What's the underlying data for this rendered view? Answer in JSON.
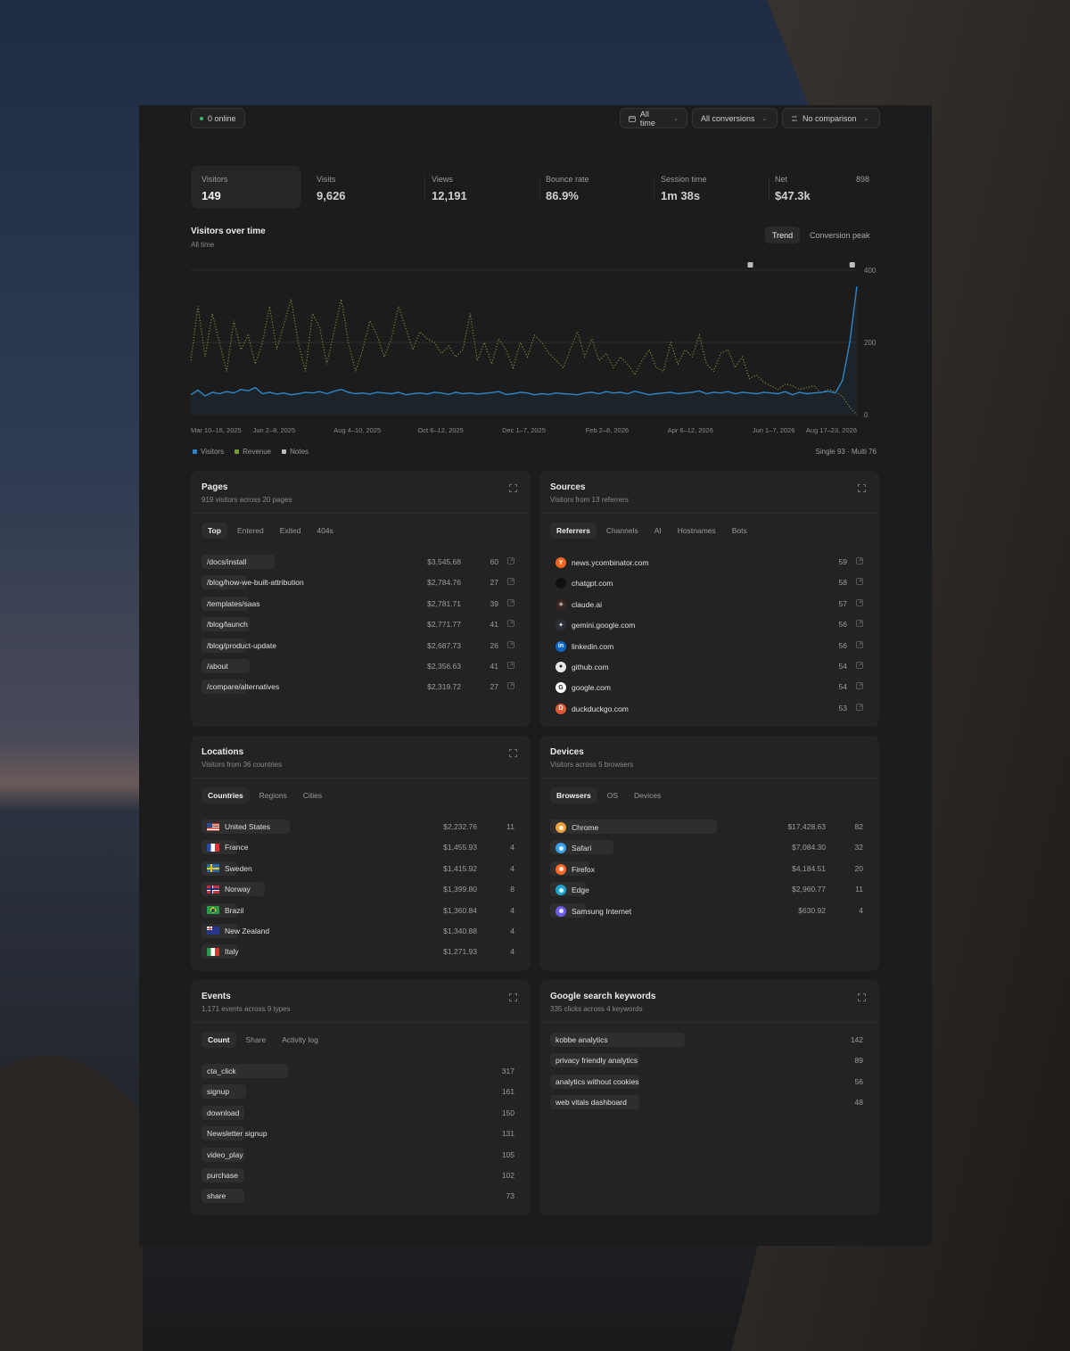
{
  "topbar": {
    "online": "0 online",
    "range": "All time",
    "conversions": "All conversions",
    "comparison": "No comparison"
  },
  "stats": [
    {
      "label": "Visitors",
      "value": "149"
    },
    {
      "label": "Visits",
      "value": "9,626"
    },
    {
      "label": "Views",
      "value": "12,191"
    },
    {
      "label": "Bounce rate",
      "value": "86.9%"
    },
    {
      "label": "Session time",
      "value": "1m 38s"
    },
    {
      "label": "Net",
      "value": "$47.3k",
      "extra": "898"
    }
  ],
  "chart": {
    "title": "Visitors over time",
    "subtitle": "All time",
    "toggle_trend": "Trend",
    "toggle_peak": "Conversion peak",
    "legend_right": "Single 93 · Multi 76",
    "colors": {
      "visitors": "#2e86c8",
      "revenue": "#8a8a3a",
      "notes": "#bdbdbd"
    }
  },
  "chart_data": {
    "type": "line",
    "x": [
      "Mar 10–16, 2025",
      "Jun 2–8, 2025",
      "Aug 4–10, 2025",
      "Oct 6–12, 2025",
      "Dec 1–7, 2025",
      "Feb 2–8, 2026",
      "Apr 6–12, 2026",
      "Jun 1–7, 2026",
      "Aug 17–23, 2026"
    ],
    "ylim": [
      0,
      400
    ],
    "yticks": [
      "0",
      "200",
      "400"
    ],
    "legend": [
      "Visitors",
      "Revenue",
      "Notes"
    ],
    "series": [
      {
        "name": "Visitors",
        "style": "solid",
        "color": "#2e86c8",
        "values": [
          55,
          68,
          52,
          62,
          58,
          64,
          60,
          70,
          66,
          75,
          58,
          62,
          57,
          60,
          55,
          58,
          62,
          60,
          64,
          58,
          65,
          70,
          62,
          58,
          60,
          57,
          62,
          60,
          58,
          62,
          55,
          58,
          60,
          57,
          62,
          60,
          56,
          62,
          58,
          60,
          57,
          59,
          61,
          64,
          56,
          58,
          62,
          60,
          55,
          58,
          56,
          60,
          58,
          57,
          55,
          60,
          62,
          58,
          64,
          60,
          62,
          58,
          65,
          60,
          55,
          58,
          60,
          62,
          58,
          60,
          62,
          66,
          58,
          62,
          60,
          64,
          58,
          62,
          60,
          58,
          62,
          60,
          58,
          64,
          55,
          62,
          58,
          60,
          62,
          65,
          60,
          95,
          200,
          355
        ]
      },
      {
        "name": "Revenue",
        "style": "dotted",
        "color": "#8a8a3a",
        "values": [
          150,
          300,
          160,
          280,
          200,
          120,
          260,
          180,
          220,
          140,
          200,
          300,
          180,
          250,
          320,
          200,
          120,
          280,
          240,
          140,
          230,
          320,
          200,
          120,
          180,
          260,
          220,
          160,
          210,
          300,
          240,
          180,
          230,
          210,
          200,
          170,
          190,
          160,
          180,
          280,
          150,
          200,
          140,
          210,
          180,
          130,
          200,
          160,
          220,
          200,
          170,
          150,
          130,
          180,
          230,
          160,
          210,
          150,
          170,
          130,
          160,
          140,
          110,
          150,
          180,
          130,
          120,
          200,
          140,
          180,
          160,
          220,
          140,
          120,
          170,
          180,
          130,
          160,
          100,
          110,
          90,
          80,
          70,
          85,
          80,
          70,
          75,
          80,
          60,
          70,
          65,
          50,
          20,
          0
        ]
      },
      {
        "name": "Notes",
        "style": "marker",
        "color": "#bdbdbd",
        "positions": [
          0.84,
          0.993
        ]
      }
    ]
  },
  "pages": {
    "title": "Pages",
    "subtitle": "919 visitors across 20 pages",
    "tabs": [
      "Top",
      "Entered",
      "Exited",
      "404s"
    ],
    "rows": [
      {
        "name": "/docs/install",
        "revenue": "$3,545.68",
        "count": "60",
        "share": 0.24
      },
      {
        "name": "/blog/how-we-built-attribution",
        "revenue": "$2,784.76",
        "count": "27",
        "share": 0.105
      },
      {
        "name": "/templates/saas",
        "revenue": "$2,781.71",
        "count": "39",
        "share": 0.155
      },
      {
        "name": "/blog/launch",
        "revenue": "$2,771.77",
        "count": "41",
        "share": 0.16
      },
      {
        "name": "/blog/product-update",
        "revenue": "$2,687.73",
        "count": "26",
        "share": 0.1
      },
      {
        "name": "/about",
        "revenue": "$2,356.63",
        "count": "41",
        "share": 0.16
      },
      {
        "name": "/compare/alternatives",
        "revenue": "$2,319.72",
        "count": "27",
        "share": 0.105
      }
    ]
  },
  "sources": {
    "title": "Sources",
    "subtitle": "Visitors from 13 referrers",
    "tabs": [
      "Referrers",
      "Channels",
      "AI",
      "Hostnames",
      "Bots"
    ],
    "rows": [
      {
        "name": "news.ycombinator.com",
        "count": "59",
        "icon": "ycombinator-icon",
        "glyph": "Y",
        "color": "#f26522"
      },
      {
        "name": "chatgpt.com",
        "count": "58",
        "icon": "chatgpt-icon",
        "glyph": "",
        "color": "#111111"
      },
      {
        "name": "claude.ai",
        "count": "57",
        "icon": "claude-icon",
        "glyph": "✳",
        "color": "#3a2620"
      },
      {
        "name": "gemini.google.com",
        "count": "56",
        "icon": "gemini-icon",
        "glyph": "✦",
        "color": "#2a2f3a"
      },
      {
        "name": "linkedin.com",
        "count": "56",
        "icon": "linkedin-icon",
        "glyph": "in",
        "color": "#0a66c2"
      },
      {
        "name": "github.com",
        "count": "54",
        "icon": "github-icon",
        "glyph": "●",
        "color": "#e8e8e8"
      },
      {
        "name": "google.com",
        "count": "54",
        "icon": "google-icon",
        "glyph": "G",
        "color": "#ffffff"
      },
      {
        "name": "duckduckgo.com",
        "count": "53",
        "icon": "duckduckgo-icon",
        "glyph": "D",
        "color": "#de5833"
      }
    ]
  },
  "locations": {
    "title": "Locations",
    "subtitle": "Visitors from 36 countries",
    "tabs": [
      "Countries",
      "Regions",
      "Cities"
    ],
    "rows": [
      {
        "name": "United States",
        "revenue": "$2,232.76",
        "count": "11",
        "flag": "us",
        "share": 0.29
      },
      {
        "name": "France",
        "revenue": "$1,455.93",
        "count": "4",
        "flag": "fr",
        "share": 0.11
      },
      {
        "name": "Sweden",
        "revenue": "$1,415.92",
        "count": "4",
        "flag": "se",
        "share": 0.11
      },
      {
        "name": "Norway",
        "revenue": "$1,399.80",
        "count": "8",
        "flag": "no",
        "share": 0.21
      },
      {
        "name": "Brazil",
        "revenue": "$1,360.84",
        "count": "4",
        "flag": "br",
        "share": 0.11
      },
      {
        "name": "New Zealand",
        "revenue": "$1,340.88",
        "count": "4",
        "flag": "nz",
        "share": 0.11
      },
      {
        "name": "Italy",
        "revenue": "$1,271.93",
        "count": "4",
        "flag": "it",
        "share": 0.11
      }
    ]
  },
  "devices": {
    "title": "Devices",
    "subtitle": "Visitors across 5 browsers",
    "tabs": [
      "Browsers",
      "OS",
      "Devices"
    ],
    "rows": [
      {
        "name": "Chrome",
        "revenue": "$17,428.63",
        "count": "82",
        "icon": "chrome-icon",
        "color": "#e8a33c",
        "share": 0.55
      },
      {
        "name": "Safari",
        "revenue": "$7,084.30",
        "count": "32",
        "icon": "safari-icon",
        "color": "#3aa0e8",
        "share": 0.21
      },
      {
        "name": "Firefox",
        "revenue": "$4,184.51",
        "count": "20",
        "icon": "firefox-icon",
        "color": "#ff6a2a",
        "share": 0.13
      },
      {
        "name": "Edge",
        "revenue": "$2,960.77",
        "count": "11",
        "icon": "edge-icon",
        "color": "#1fa3c8",
        "share": 0.07
      },
      {
        "name": "Samsung Internet",
        "revenue": "$630.92",
        "count": "4",
        "icon": "samsung-internet-icon",
        "color": "#6b5ce7",
        "share": 0.03
      }
    ]
  },
  "events": {
    "title": "Events",
    "subtitle": "1,171 events across 9 types",
    "tabs": [
      "Count",
      "Share",
      "Activity log"
    ],
    "rows": [
      {
        "name": "cta_click",
        "count": "317",
        "share": 0.27
      },
      {
        "name": "signup",
        "count": "161",
        "share": 0.14
      },
      {
        "name": "download",
        "count": "150",
        "share": 0.13
      },
      {
        "name": "Newsletter signup",
        "count": "131",
        "share": 0.11
      },
      {
        "name": "video_play",
        "count": "105",
        "share": 0.09
      },
      {
        "name": "purchase",
        "count": "102",
        "share": 0.09
      },
      {
        "name": "share",
        "count": "73",
        "share": 0.06
      }
    ]
  },
  "keywords": {
    "title": "Google search keywords",
    "subtitle": "335 clicks across 4 keywords",
    "rows": [
      {
        "name": "kobbe analytics",
        "count": "142",
        "share": 0.42
      },
      {
        "name": "privacy friendly analytics",
        "count": "89",
        "share": 0.27
      },
      {
        "name": "analytics without cookies",
        "count": "56",
        "share": 0.17
      },
      {
        "name": "web vitals dashboard",
        "count": "48",
        "share": 0.14
      }
    ]
  }
}
